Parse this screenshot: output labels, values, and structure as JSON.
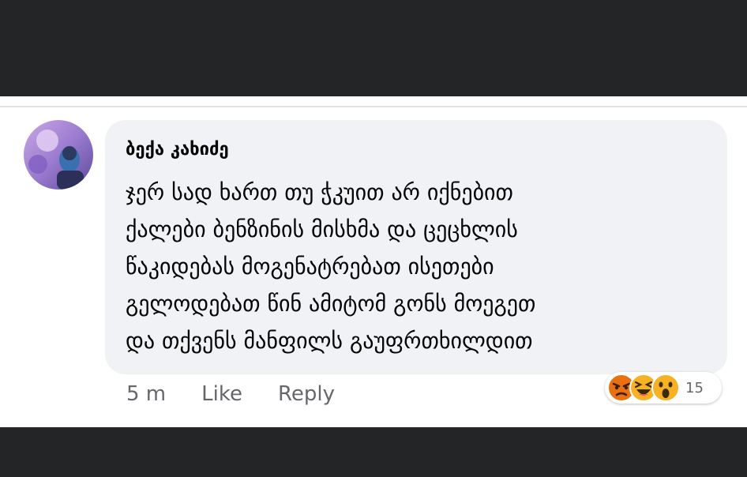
{
  "comment": {
    "author": "ბექა კახიძე",
    "lines": [
      "ჯერ სად ხართ თუ ჭკუით არ იქნებით",
      "ქალები ბენზინის მისხმა და ცეცხლის",
      "წაკიდებას მოგენატრებათ ისეთები",
      "გელოდებათ წინ ამიტომ გონს მოეგეთ",
      "და თქვენს მანფილს გაუფრთხილდით"
    ],
    "timestamp": "5 m",
    "like_label": "Like",
    "reply_label": "Reply",
    "reactions": {
      "icons": [
        "angry-reaction-icon",
        "haha-reaction-icon",
        "wow-reaction-icon"
      ],
      "count": "15"
    }
  },
  "colors": {
    "background": "#242526",
    "bubble": "#f0f2f5",
    "muted_text": "#65676b",
    "angry": "#e9710f",
    "haha_wow": "#f7b125"
  }
}
